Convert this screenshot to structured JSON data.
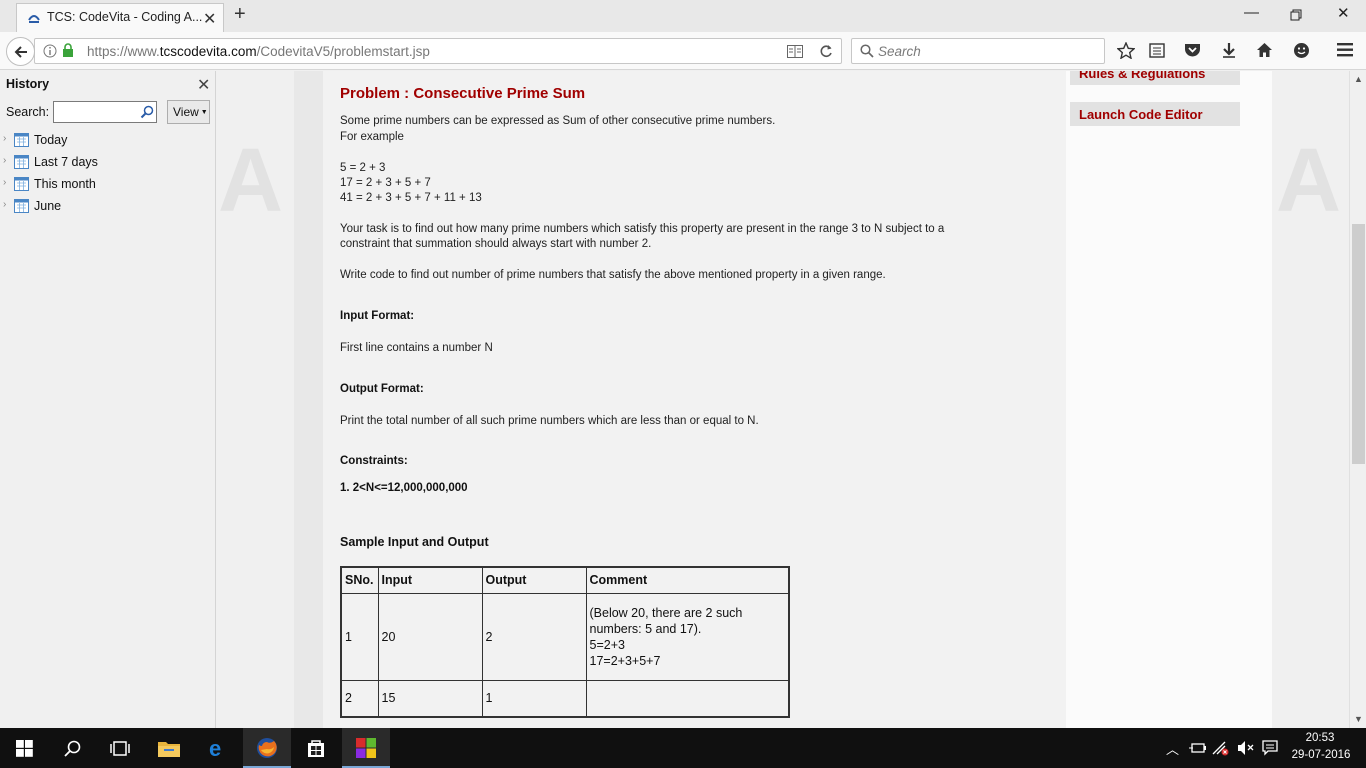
{
  "browser": {
    "tab_title": "TCS: CodeVita - Coding A...",
    "url_prefix": "https://www.",
    "url_domain": "tcscodevita.com",
    "url_path": "/CodevitaV5/problemstart.jsp",
    "search_placeholder": "Search"
  },
  "sidebar": {
    "title": "History",
    "search_label": "Search:",
    "view_label": "View",
    "items": [
      {
        "label": "Today"
      },
      {
        "label": "Last 7 days"
      },
      {
        "label": "This month"
      },
      {
        "label": "June"
      }
    ]
  },
  "right_panel": {
    "rules_label": "Rules & Regulations",
    "launch_label": "Launch Code Editor"
  },
  "problem": {
    "title": "Problem : Consecutive Prime Sum",
    "intro_1": "Some prime numbers can be expressed as Sum of other consecutive prime numbers.",
    "intro_2": "For example",
    "example_1": "5 = 2 + 3",
    "example_2": "17 = 2 + 3 + 5 + 7",
    "example_3": "41 = 2 + 3 + 5 + 7 + 11 + 13",
    "task_1": "Your task is to find out how many prime numbers which satisfy this property are present in the range 3 to N subject to a",
    "task_2": "constraint that summation should always start with number 2.",
    "task_3": "Write code to find out number of prime numbers that satisfy the above mentioned property in a given range.",
    "input_heading": "Input Format:",
    "input_text": "First line contains a number N",
    "output_heading": "Output Format:",
    "output_text": "Print the total number of all such prime numbers which are less than or equal to N.",
    "constraints_heading": "Constraints:",
    "constraints_text": "1. 2<N<=12,000,000,000",
    "sample_heading": "Sample Input and Output"
  },
  "samples_table": {
    "headers": [
      "SNo.",
      "Input",
      "Output",
      "Comment"
    ],
    "rows": [
      {
        "sno": "1",
        "input": "20",
        "output": "2",
        "comment_1": "(Below 20, there are 2 such",
        "comment_2": "numbers: 5 and 17).",
        "comment_3": "5=2+3",
        "comment_4": "17=2+3+5+7"
      },
      {
        "sno": "2",
        "input": "15",
        "output": "1"
      }
    ]
  },
  "taskbar": {
    "time": "20:53",
    "date": "29-07-2016"
  }
}
